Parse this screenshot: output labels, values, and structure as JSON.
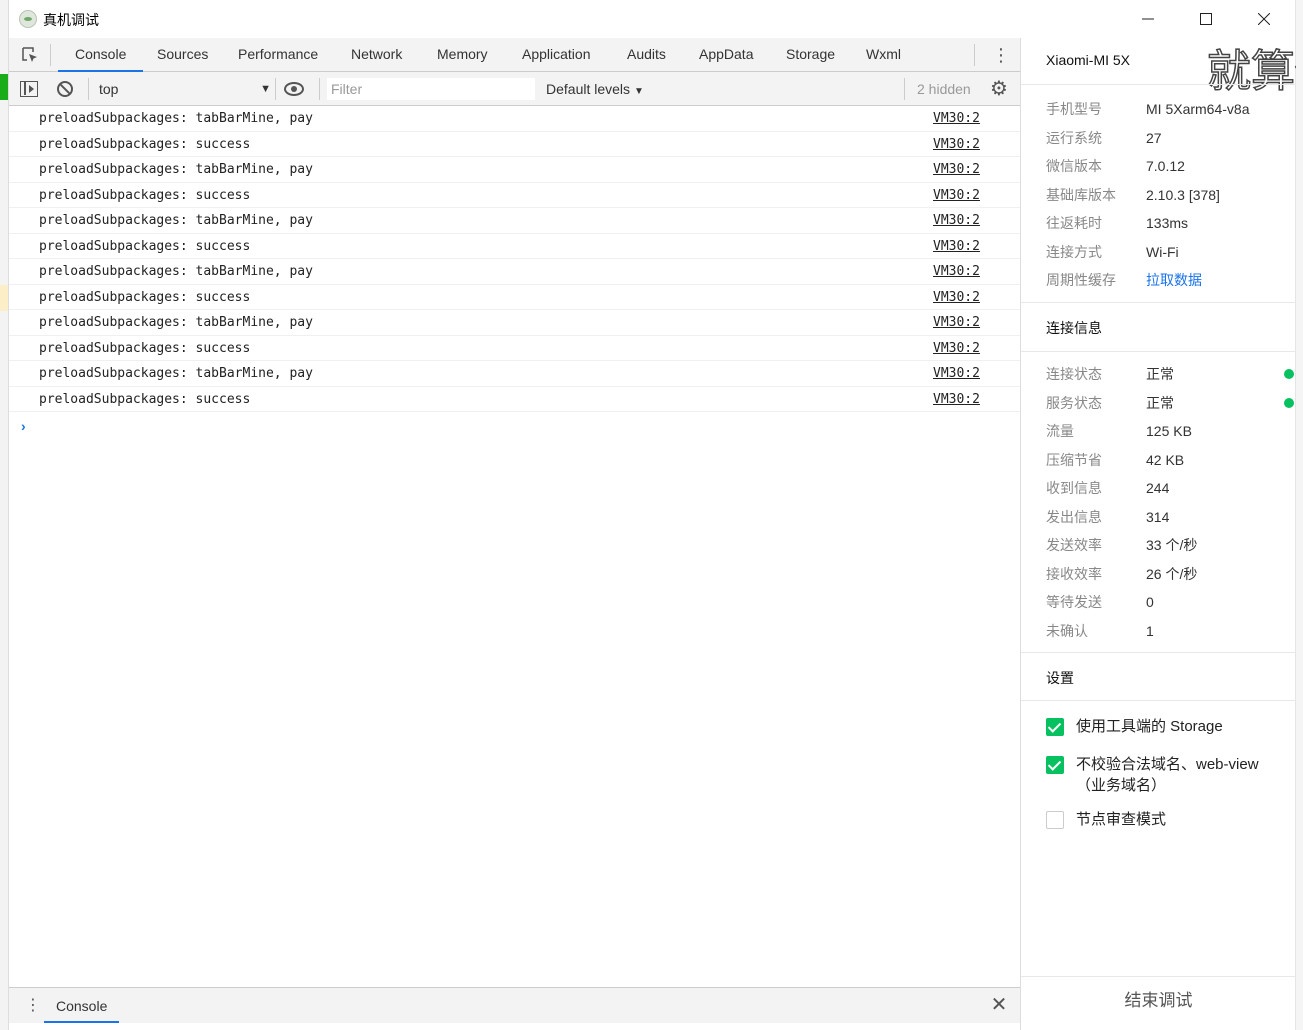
{
  "window": {
    "title": "真机调试"
  },
  "tabs": [
    "Console",
    "Sources",
    "Performance",
    "Network",
    "Memory",
    "Application",
    "Audits",
    "AppData",
    "Storage",
    "Wxml"
  ],
  "active_tab": "Console",
  "toolbar": {
    "context": "top",
    "filter_placeholder": "Filter",
    "levels": "Default levels",
    "hidden": "2 hidden"
  },
  "log": [
    {
      "msg": "preloadSubpackages: tabBarMine, pay",
      "src": "VM30:2"
    },
    {
      "msg": "preloadSubpackages: success",
      "src": "VM30:2"
    },
    {
      "msg": "preloadSubpackages: tabBarMine, pay",
      "src": "VM30:2"
    },
    {
      "msg": "preloadSubpackages: success",
      "src": "VM30:2"
    },
    {
      "msg": "preloadSubpackages: tabBarMine, pay",
      "src": "VM30:2"
    },
    {
      "msg": "preloadSubpackages: success",
      "src": "VM30:2"
    },
    {
      "msg": "preloadSubpackages: tabBarMine, pay",
      "src": "VM30:2"
    },
    {
      "msg": "preloadSubpackages: success",
      "src": "VM30:2"
    },
    {
      "msg": "preloadSubpackages: tabBarMine, pay",
      "src": "VM30:2"
    },
    {
      "msg": "preloadSubpackages: success",
      "src": "VM30:2"
    },
    {
      "msg": "preloadSubpackages: tabBarMine, pay",
      "src": "VM30:2"
    },
    {
      "msg": "preloadSubpackages: success",
      "src": "VM30:2"
    }
  ],
  "prompt": "›",
  "drawer": {
    "tab": "Console"
  },
  "device": {
    "name": "Xiaomi-MI 5X",
    "watermark": "就算你",
    "info": [
      {
        "k": "手机型号",
        "v": "MI 5Xarm64-v8a"
      },
      {
        "k": "运行系统",
        "v": "27"
      },
      {
        "k": "微信版本",
        "v": "7.0.12"
      },
      {
        "k": "基础库版本",
        "v": "2.10.3 [378]"
      },
      {
        "k": "往返耗时",
        "v": "133ms"
      },
      {
        "k": "连接方式",
        "v": "Wi-Fi"
      },
      {
        "k": "周期性缓存",
        "v": "拉取数据"
      }
    ]
  },
  "connection": {
    "title": "连接信息",
    "items": [
      {
        "k": "连接状态",
        "v": "正常"
      },
      {
        "k": "服务状态",
        "v": "正常"
      },
      {
        "k": "流量",
        "v": "125 KB"
      },
      {
        "k": "压缩节省",
        "v": "42 KB"
      },
      {
        "k": "收到信息",
        "v": "244"
      },
      {
        "k": "发出信息",
        "v": "314"
      },
      {
        "k": "发送效率",
        "v": "33 个/秒"
      },
      {
        "k": "接收效率",
        "v": "26 个/秒"
      },
      {
        "k": "等待发送",
        "v": "0"
      },
      {
        "k": "未确认",
        "v": "1"
      }
    ],
    "status_color": "#07c160"
  },
  "settings": {
    "title": "设置",
    "options": [
      {
        "label": "使用工具端的 Storage",
        "checked": true
      },
      {
        "label": "不校验合法域名、web-view（业务域名）",
        "checked": true
      },
      {
        "label": "节点审查模式",
        "checked": false
      }
    ]
  },
  "end_button": "结束调试",
  "colors": {
    "accent": "#1a73e8",
    "green": "#07c160"
  }
}
